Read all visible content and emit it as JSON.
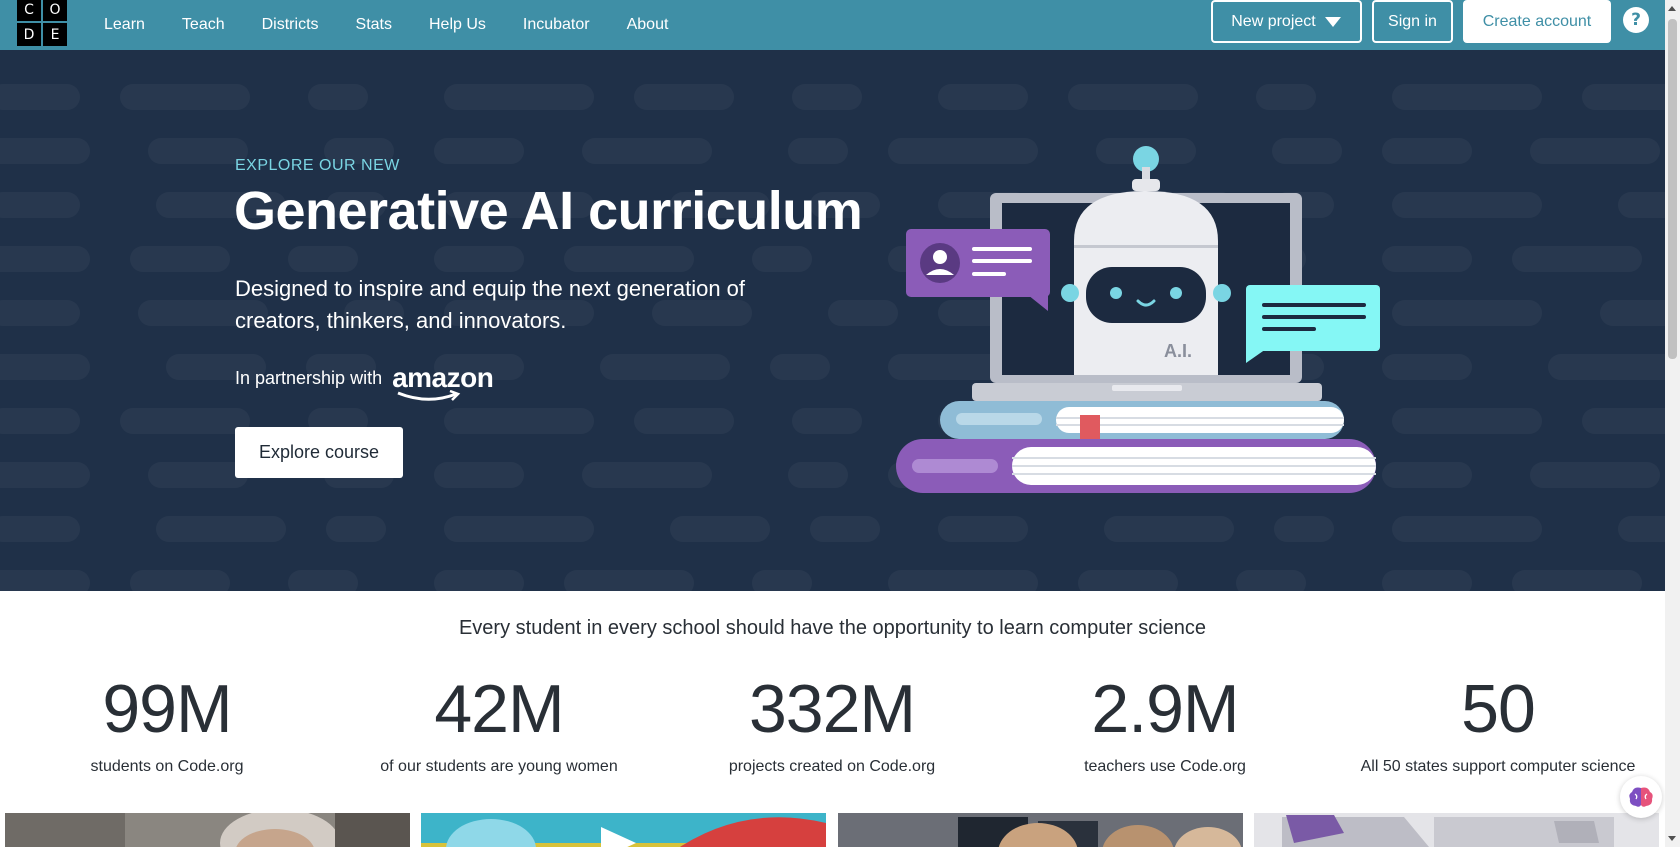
{
  "logo": {
    "letters": [
      "C",
      "O",
      "D",
      "E"
    ]
  },
  "nav": {
    "links": [
      "Learn",
      "Teach",
      "Districts",
      "Stats",
      "Help Us",
      "Incubator",
      "About"
    ],
    "new_project": "New project",
    "sign_in": "Sign in",
    "create_account": "Create account",
    "help": "?"
  },
  "hero": {
    "eyebrow": "EXPLORE OUR NEW",
    "title": "Generative AI curriculum",
    "subtitle": "Designed to inspire and equip the next generation of creators, thinkers, and innovators.",
    "partnership": "In partnership with",
    "partner_logo": "amazon",
    "cta": "Explore course",
    "robot_label": "A.I."
  },
  "mission": "Every student in every school should have the opportunity to learn computer science",
  "stats": [
    {
      "value": "99M",
      "label": "students on Code.org"
    },
    {
      "value": "42M",
      "label": "of our students are young women"
    },
    {
      "value": "332M",
      "label": "projects created on Code.org"
    },
    {
      "value": "2.9M",
      "label": "teachers use Code.org"
    },
    {
      "value": "50",
      "label": "All 50 states support computer science"
    }
  ],
  "colors": {
    "nav_bg": "#3f8fa6",
    "hero_bg": "#1f3048",
    "accent_teal": "#7ad5e3",
    "purple": "#8b5cb8",
    "cyan": "#85f7f5"
  }
}
